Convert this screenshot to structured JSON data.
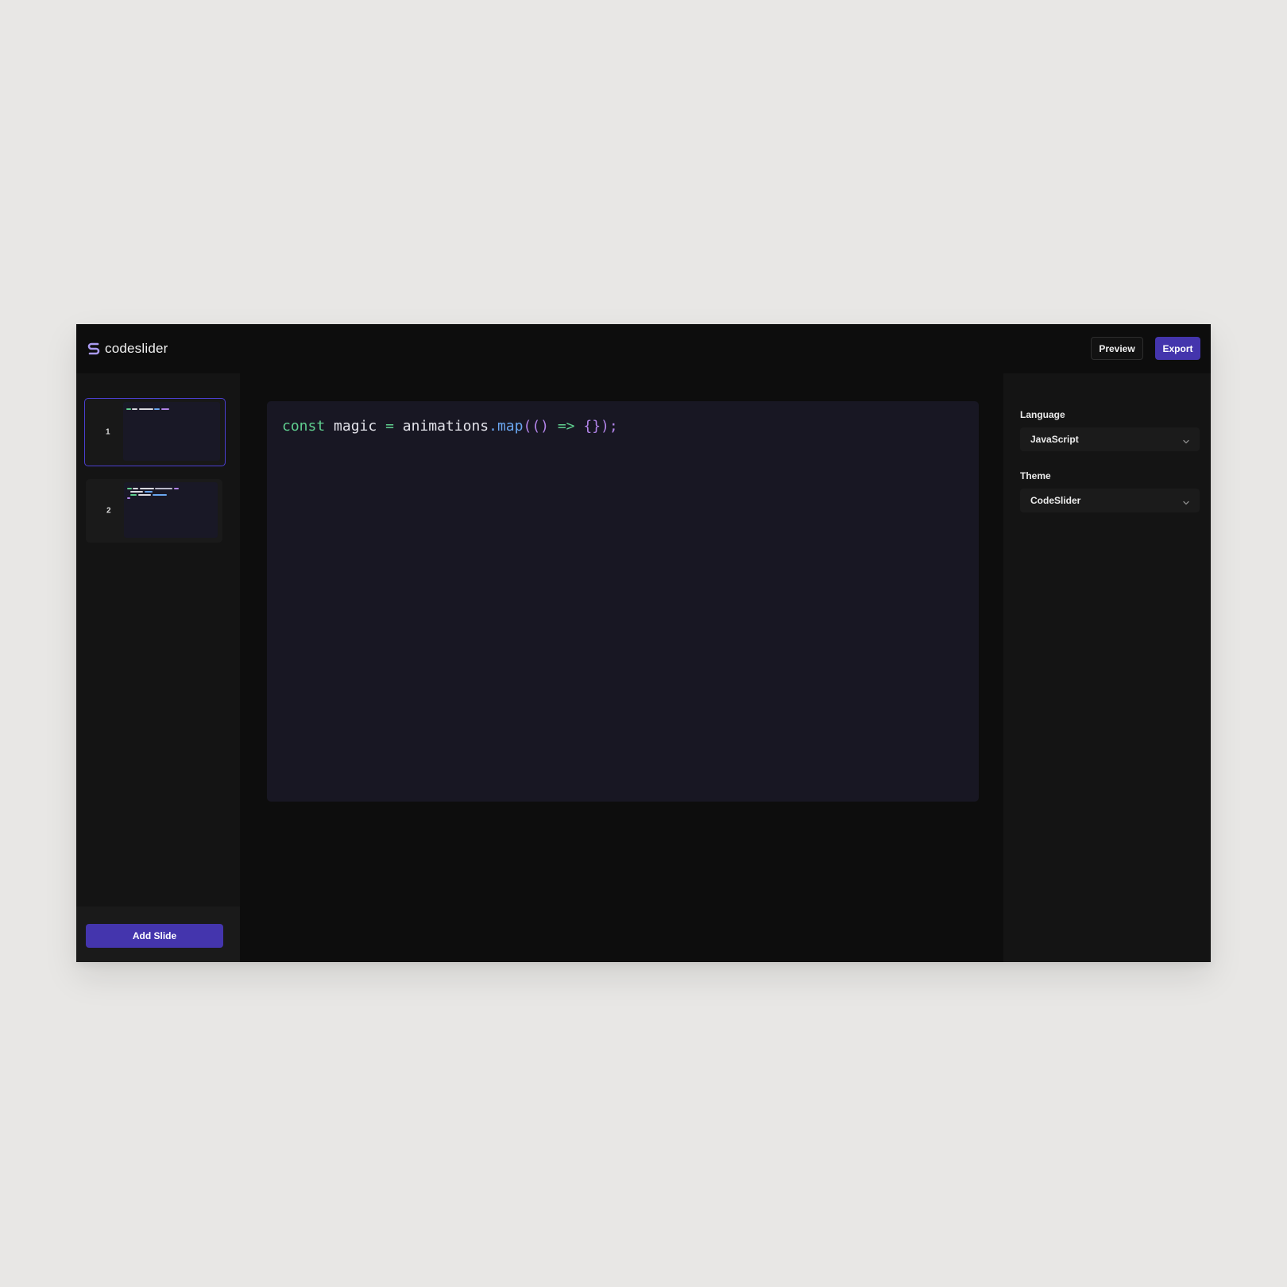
{
  "app": {
    "brand_name": "codeslider"
  },
  "toolbar": {
    "preview_label": "Preview",
    "export_label": "Export"
  },
  "sidebar": {
    "slides": [
      {
        "number": "1",
        "active": true
      },
      {
        "number": "2",
        "active": false
      }
    ],
    "add_slide_label": "Add Slide"
  },
  "editor": {
    "code_tokens": [
      "const",
      " ",
      "magic",
      " ",
      "=",
      " ",
      "animations",
      ".",
      "map",
      "(()",
      " ",
      "=>",
      " ",
      "{});"
    ]
  },
  "settings": {
    "language": {
      "label": "Language",
      "value": "JavaScript"
    },
    "theme": {
      "label": "Theme",
      "value": "CodeSlider"
    }
  },
  "colors": {
    "accent": "#4435ad",
    "keyword": "#5fce8f",
    "function": "#6aa6f0",
    "bracket": "#b183e8"
  },
  "icons": [
    "codeslider-logo-icon",
    "chevron-down-icon"
  ]
}
